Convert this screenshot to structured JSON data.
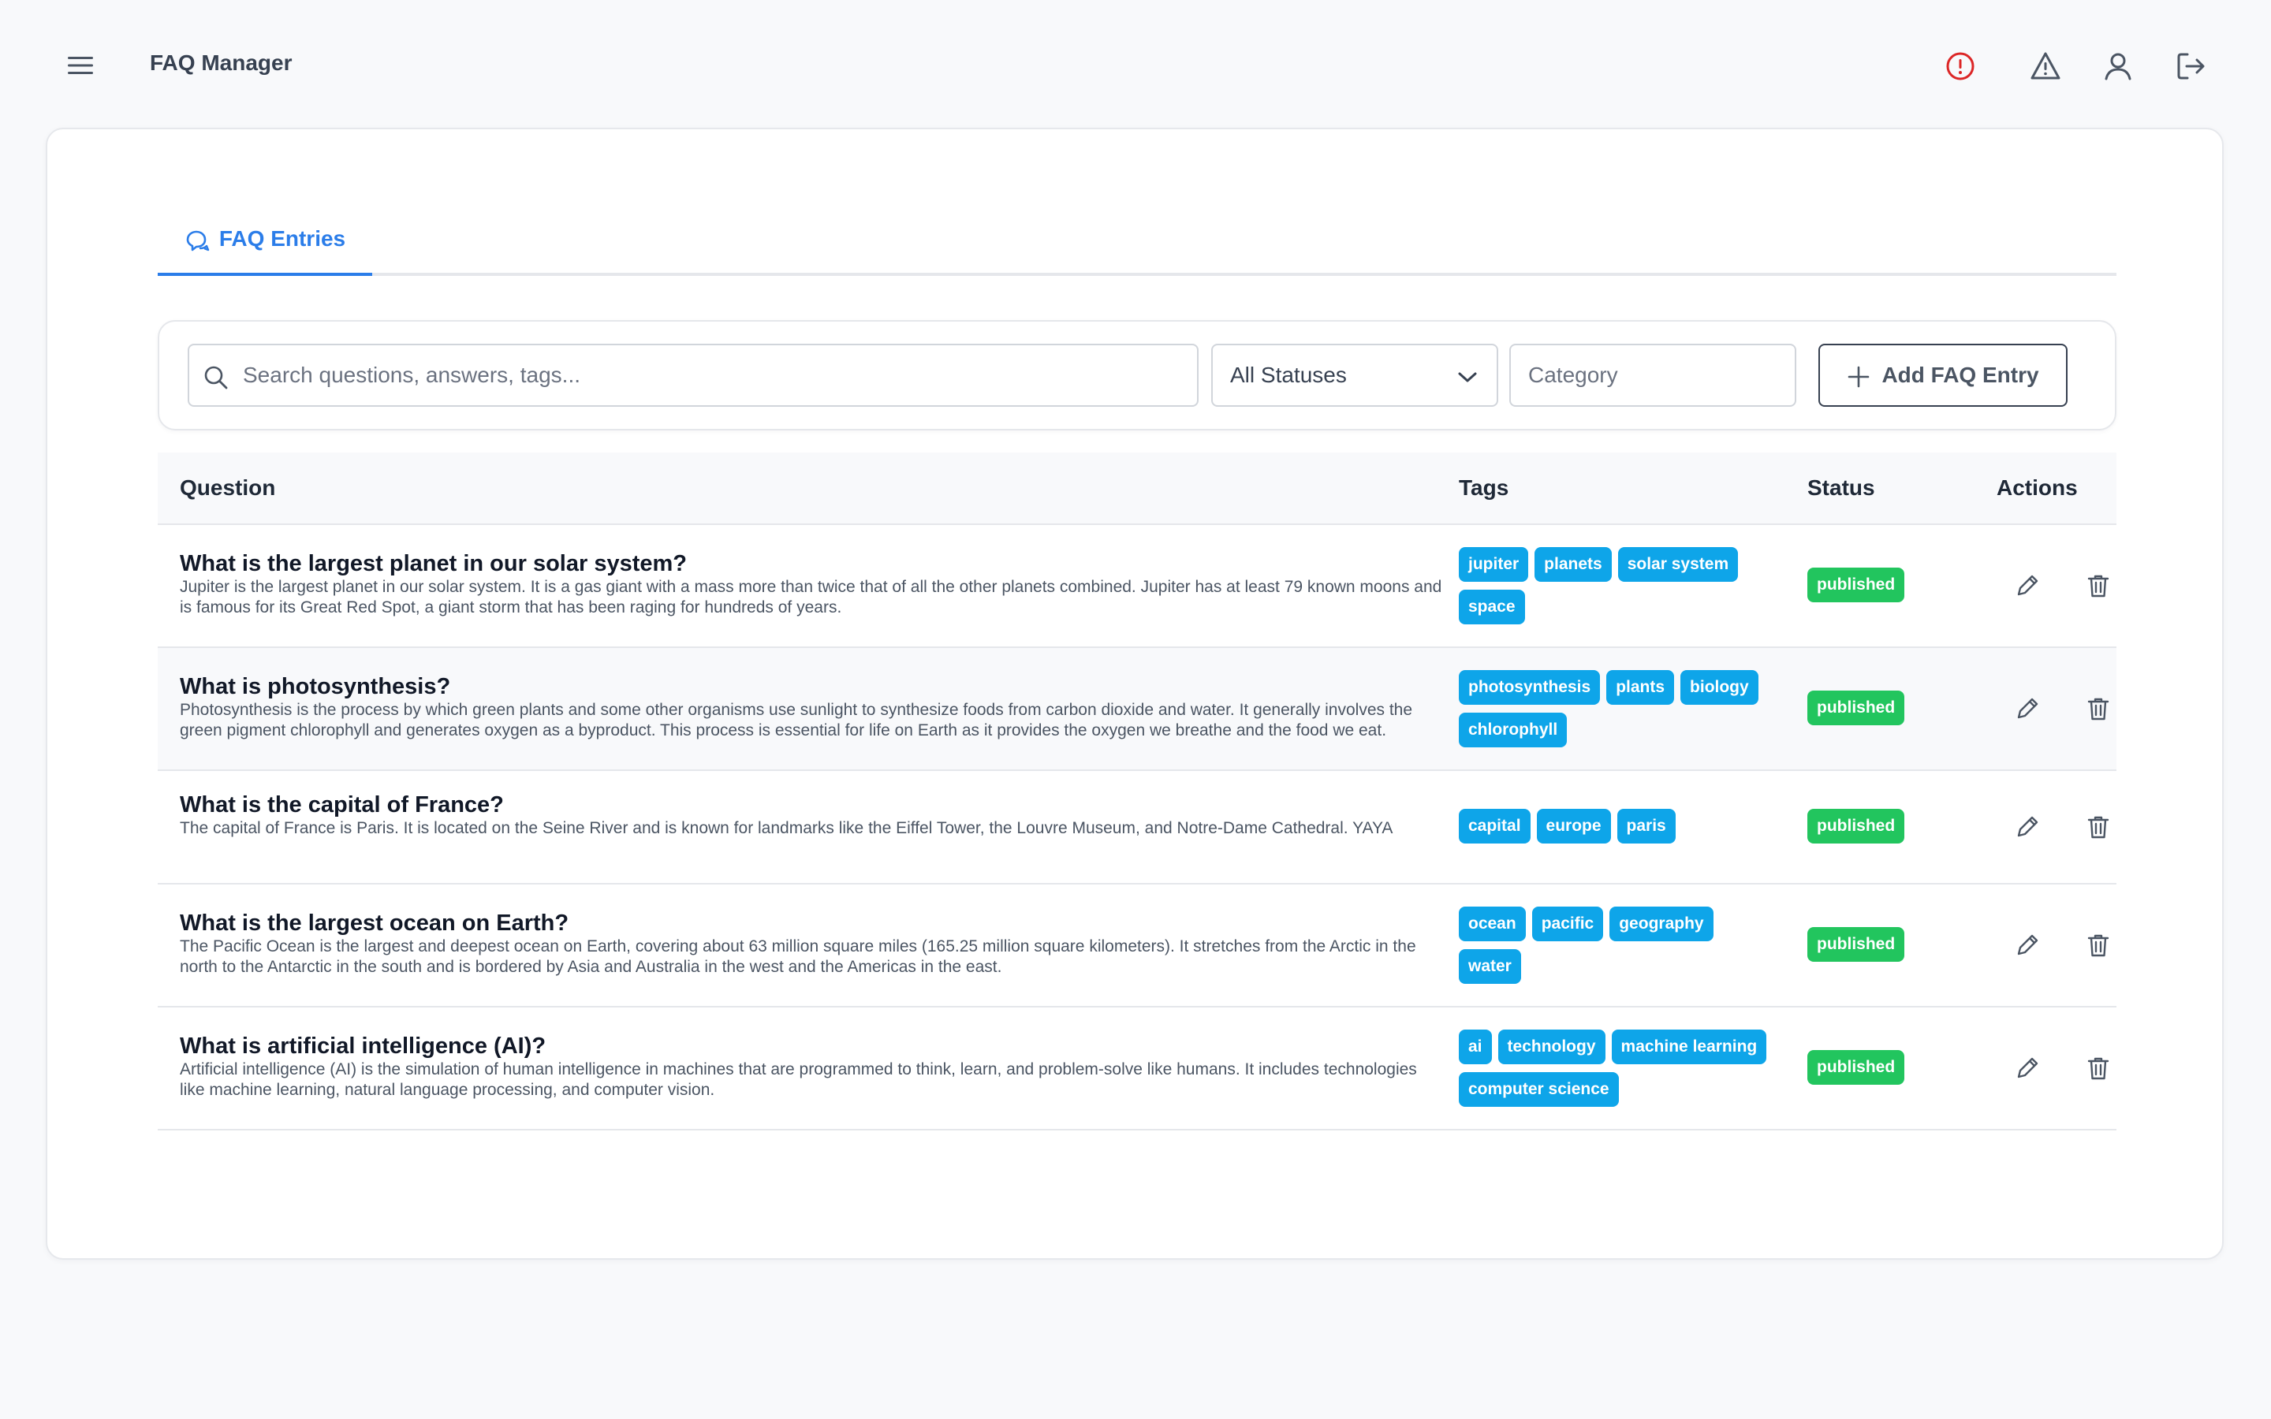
{
  "header": {
    "title": "FAQ Manager",
    "menu_icon": "hamburger-menu-icon",
    "actions": [
      {
        "name": "error-alert-icon",
        "color": "#dc2626"
      },
      {
        "name": "warning-icon",
        "color": "#4b5563"
      },
      {
        "name": "user-icon",
        "color": "#4b5563"
      },
      {
        "name": "logout-icon",
        "color": "#4b5563"
      }
    ]
  },
  "tabs": [
    {
      "label": "FAQ Entries",
      "icon": "chat-bubbles-icon",
      "active": true
    }
  ],
  "filters": {
    "search_placeholder": "Search questions, answers, tags...",
    "search_value": "",
    "status_selected": "All Statuses",
    "category_placeholder": "Category",
    "category_value": "",
    "add_button_label": "Add FAQ Entry"
  },
  "table": {
    "columns": [
      "Question",
      "Tags",
      "Status",
      "Actions"
    ],
    "rows": [
      {
        "question": "What is the largest planet in our solar system?",
        "answer": "Jupiter is the largest planet in our solar system. It is a gas giant with a mass more than twice that of all the other planets combined. Jupiter has at least 79 known moons and is famous for its Great Red Spot, a giant storm that has been raging for hundreds of years.",
        "tags": [
          "jupiter",
          "planets",
          "solar system",
          "space"
        ],
        "status": "published"
      },
      {
        "question": "What is photosynthesis?",
        "answer": "Photosynthesis is the process by which green plants and some other organisms use sunlight to synthesize foods from carbon dioxide and water. It generally involves the green pigment chlorophyll and generates oxygen as a byproduct. This process is essential for life on Earth as it provides the oxygen we breathe and the food we eat.",
        "tags": [
          "photosynthesis",
          "plants",
          "biology",
          "chlorophyll"
        ],
        "status": "published"
      },
      {
        "question": "What is the capital of France?",
        "answer": "The capital of France is Paris. It is located on the Seine River and is known for landmarks like the Eiffel Tower, the Louvre Museum, and Notre-Dame Cathedral. YAYA",
        "tags": [
          "capital",
          "europe",
          "paris"
        ],
        "status": "published"
      },
      {
        "question": "What is the largest ocean on Earth?",
        "answer": "The Pacific Ocean is the largest and deepest ocean on Earth, covering about 63 million square miles (165.25 million square kilometers). It stretches from the Arctic in the north to the Antarctic in the south and is bordered by Asia and Australia in the west and the Americas in the east.",
        "tags": [
          "ocean",
          "pacific",
          "geography",
          "water"
        ],
        "status": "published"
      },
      {
        "question": "What is artificial intelligence (AI)?",
        "answer": "Artificial intelligence (AI) is the simulation of human intelligence in machines that are programmed to think, learn, and problem-solve like humans. It includes technologies like machine learning, natural language processing, and computer vision.",
        "tags": [
          "ai",
          "technology",
          "machine learning",
          "computer science"
        ],
        "status": "published"
      }
    ],
    "row_actions": [
      "edit-pencil-icon",
      "delete-trash-icon"
    ]
  },
  "colors": {
    "accent": "#2b7de9",
    "tag": "#0ea5e9",
    "status_published": "#22c55e",
    "alert": "#dc2626"
  }
}
